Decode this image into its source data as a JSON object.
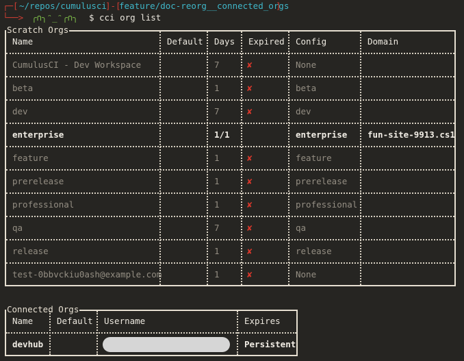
{
  "prompt": {
    "path": "~/repos/cumulusci",
    "branch": "feature/doc-reorg__connected_orgs",
    "face": "╭∩╮ᵔ_ᵔ╭∩╮",
    "symbol": "$",
    "command": "cci org list"
  },
  "scratch": {
    "title": "Scratch Orgs",
    "headers": [
      "Name",
      "Default",
      "Days",
      "Expired",
      "Config",
      "Domain"
    ],
    "rows": [
      {
        "name": "CumulusCI - Dev Workspace",
        "default": "",
        "days": "7",
        "expired": "✘",
        "config": "None",
        "domain": "",
        "active": false
      },
      {
        "name": "beta",
        "default": "",
        "days": "1",
        "expired": "✘",
        "config": "beta",
        "domain": "",
        "active": false
      },
      {
        "name": "dev",
        "default": "",
        "days": "7",
        "expired": "✘",
        "config": "dev",
        "domain": "",
        "active": false
      },
      {
        "name": "enterprise",
        "default": "",
        "days": "1/1",
        "expired": "",
        "config": "enterprise",
        "domain": "fun-site-9913.cs1",
        "active": true
      },
      {
        "name": "feature",
        "default": "",
        "days": "1",
        "expired": "✘",
        "config": "feature",
        "domain": "",
        "active": false
      },
      {
        "name": "prerelease",
        "default": "",
        "days": "1",
        "expired": "✘",
        "config": "prerelease",
        "domain": "",
        "active": false
      },
      {
        "name": "professional",
        "default": "",
        "days": "1",
        "expired": "✘",
        "config": "professional",
        "domain": "",
        "active": false
      },
      {
        "name": "qa",
        "default": "",
        "days": "7",
        "expired": "✘",
        "config": "qa",
        "domain": "",
        "active": false
      },
      {
        "name": "release",
        "default": "",
        "days": "1",
        "expired": "✘",
        "config": "release",
        "domain": "",
        "active": false
      },
      {
        "name": "test-0bbvckiu0ash@example.com",
        "default": "",
        "days": "1",
        "expired": "✘",
        "config": "None",
        "domain": "",
        "active": false
      }
    ]
  },
  "connected": {
    "title": "Connected Orgs",
    "headers": [
      "Name",
      "Default",
      "Username",
      "Expires"
    ],
    "rows": [
      {
        "name": "devhub",
        "default": "",
        "username": "",
        "expires": "Persistent"
      }
    ]
  },
  "colors": {
    "background": "#262522",
    "prompt_red": "#cc3d33",
    "prompt_cyan": "#3fb6c8",
    "prompt_green": "#7fbf4a",
    "expired_x": "#d8372b"
  }
}
